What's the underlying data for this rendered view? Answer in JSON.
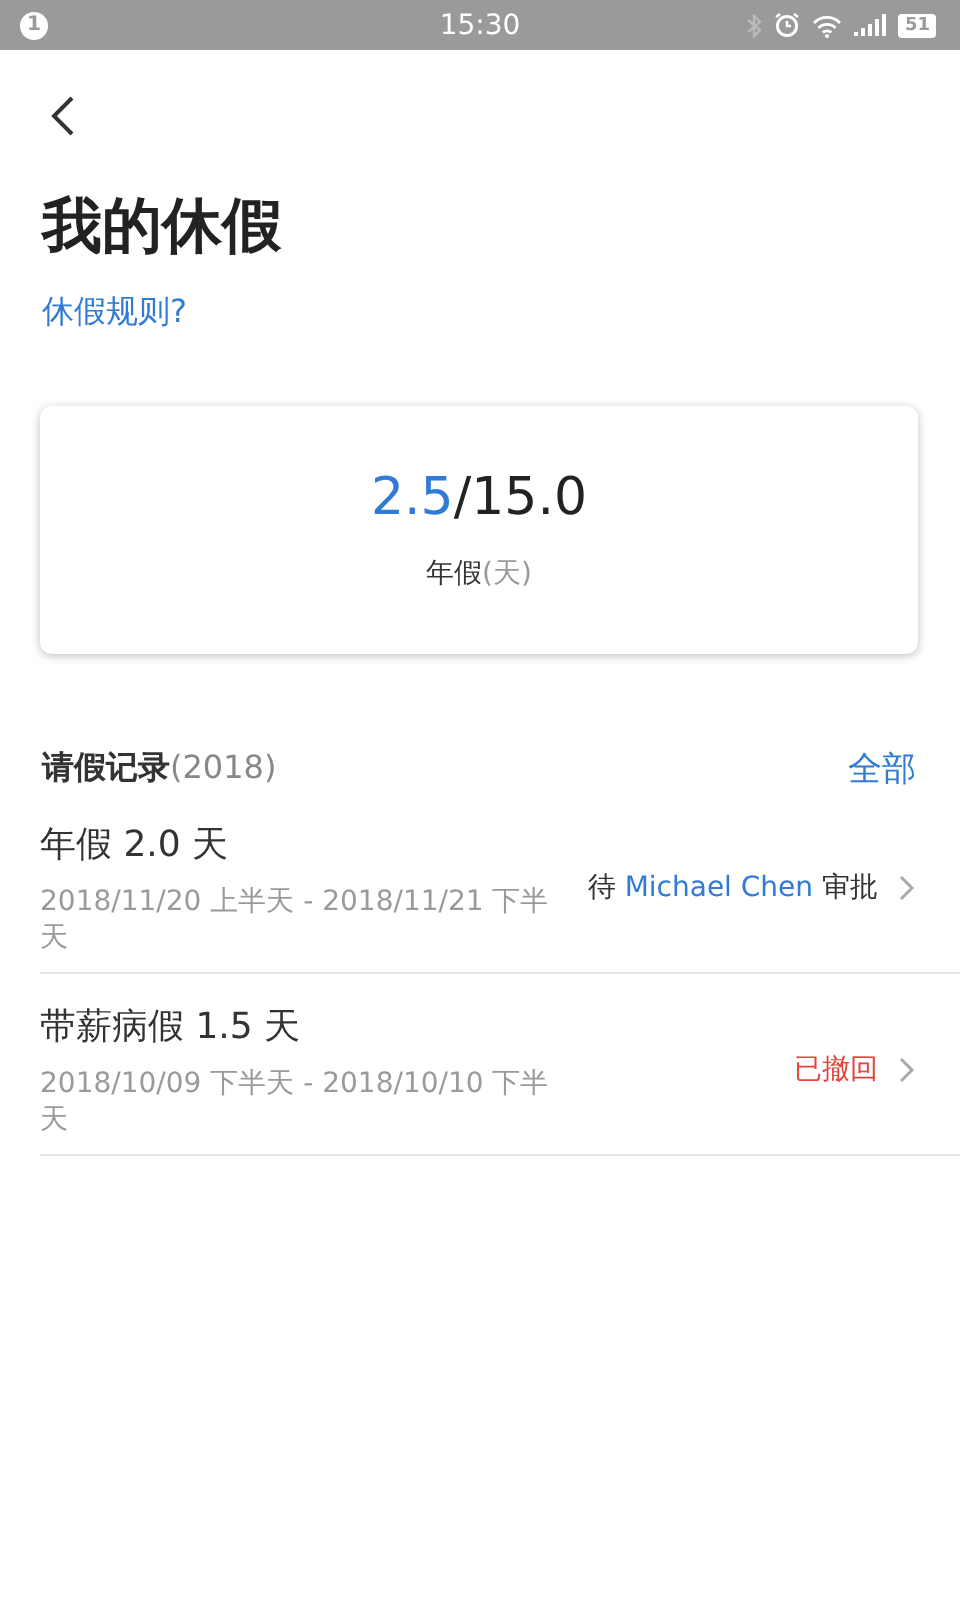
{
  "status_bar": {
    "notification_count": "1",
    "time": "15:30",
    "battery": "51"
  },
  "title": "我的休假",
  "rules_link": "休假规则?",
  "balance": {
    "used": "2.5",
    "total": "/15.0",
    "label": "年假",
    "unit": "(天)"
  },
  "records": {
    "title": "请假记录",
    "year": "(2018)",
    "all_link": "全部",
    "items": [
      {
        "title": "年假 2.0 天",
        "dates": "2018/11/20 上半天 - 2018/11/21 下半天",
        "kind": "pending",
        "status_prefix": "待 ",
        "approver": "Michael Chen",
        "status_suffix": " 审批"
      },
      {
        "title": "带薪病假 1.5 天",
        "dates": "2018/10/09 下半天 - 2018/10/10 下半天",
        "kind": "withdrawn",
        "status": "已撤回"
      }
    ]
  }
}
